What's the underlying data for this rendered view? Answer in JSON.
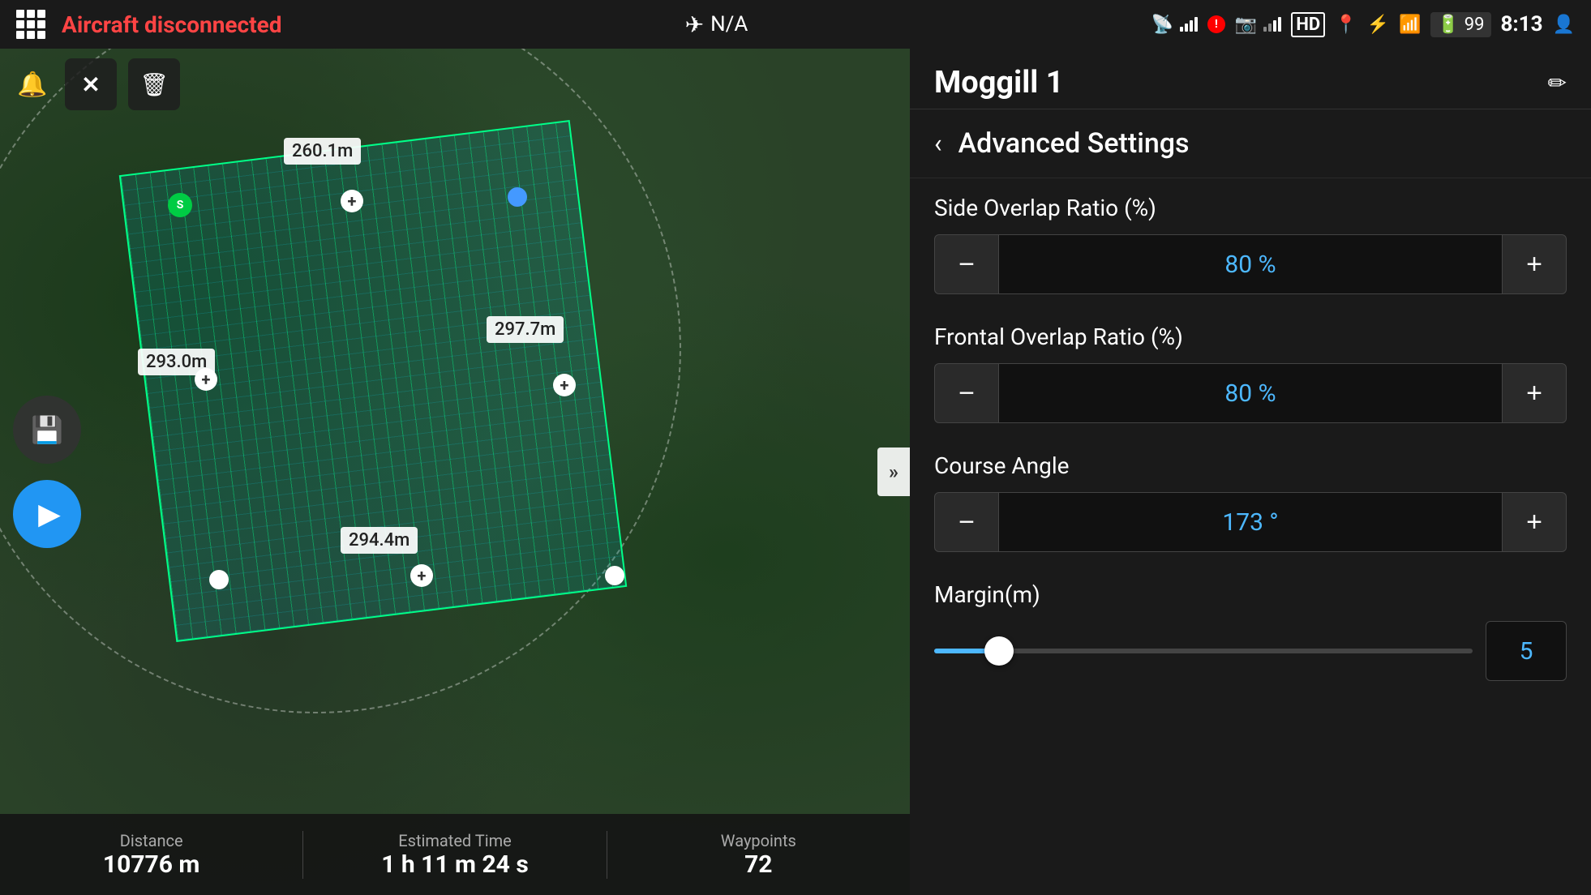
{
  "statusBar": {
    "aircraftStatus": "Aircraft disconnected",
    "naLabel": "N/A",
    "batteryPct": "99",
    "time": "8:13"
  },
  "mapControls": {
    "deleteLabel": "✕",
    "trashLabel": "🗑",
    "collapseLabel": "»"
  },
  "distanceLabels": [
    {
      "id": "top",
      "value": "260.1m"
    },
    {
      "id": "left",
      "value": "293.0m"
    },
    {
      "id": "right",
      "value": "297.7m"
    },
    {
      "id": "bottom",
      "value": "294.4m"
    }
  ],
  "bottomStats": {
    "distanceLabel": "Distance",
    "distanceValue": "10776 m",
    "timeLabel": "Estimated Time",
    "timeValue": "1 h 11 m 24 s",
    "waypointsLabel": "Waypoints",
    "waypointsValue": "72"
  },
  "panel": {
    "title": "Moggill 1",
    "editIcon": "✏",
    "advancedSettings": {
      "backLabel": "‹",
      "title": "Advanced Settings",
      "sideOverlap": {
        "label": "Side Overlap Ratio (%)",
        "value": "80 %",
        "minusLabel": "−",
        "plusLabel": "+"
      },
      "frontalOverlap": {
        "label": "Frontal Overlap Ratio (%)",
        "value": "80 %",
        "minusLabel": "−",
        "plusLabel": "+"
      },
      "courseAngle": {
        "label": "Course Angle",
        "value": "173 °",
        "minusLabel": "−",
        "plusLabel": "+"
      },
      "margin": {
        "label": "Margin(m)",
        "sliderValue": 5,
        "displayValue": "5"
      }
    }
  }
}
